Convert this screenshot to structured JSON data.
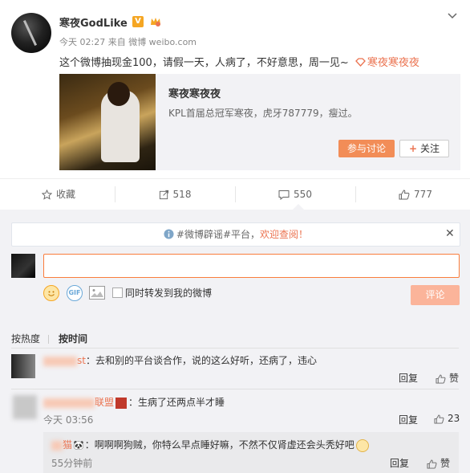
{
  "post": {
    "username": "寒夜GodLike",
    "verified_badge": "V",
    "time_source": "今天 02:27 来自 微博 weibo.com",
    "text": "这个微博抽现金100，请假一天，人病了，不好意思，周一见~",
    "topic": "寒夜寒夜夜",
    "card": {
      "title": "寒夜寒夜夜",
      "desc": "KPL首届总冠军寒夜，虎牙787779，瘦过。",
      "join_label": "参与讨论",
      "follow_label": "关注"
    }
  },
  "actions": {
    "favorite": "收藏",
    "repost": "518",
    "comment": "550",
    "like": "777"
  },
  "notice": {
    "text": "#微博辟谣#平台，",
    "link": "欢迎查阅！"
  },
  "composer": {
    "forward_label": "同时转发到我的微博",
    "submit_label": "评论"
  },
  "sort": {
    "hot": "按热度",
    "time": "按时间"
  },
  "comments": [
    {
      "user": "st",
      "text": "：去和别的平台谈合作，说的这么好听，还病了，违心",
      "reply": "回复",
      "like": "赞",
      "time": ""
    },
    {
      "user": "联盟",
      "text": "：生病了还两点半才睡",
      "time": "今天 03:56",
      "reply": "回复",
      "like": "23"
    }
  ],
  "subcomment": {
    "user": "猫",
    "text": "：啊啊啊狗贼，你特么早点睡好嘛，不然不仅肾虚还会头秃好吧",
    "time": "55分钟前",
    "reply": "回复",
    "like": "赞"
  },
  "colors": {
    "accent": "#eb7350",
    "join_button": "#f28d57",
    "comment_button": "#fbb49a"
  }
}
